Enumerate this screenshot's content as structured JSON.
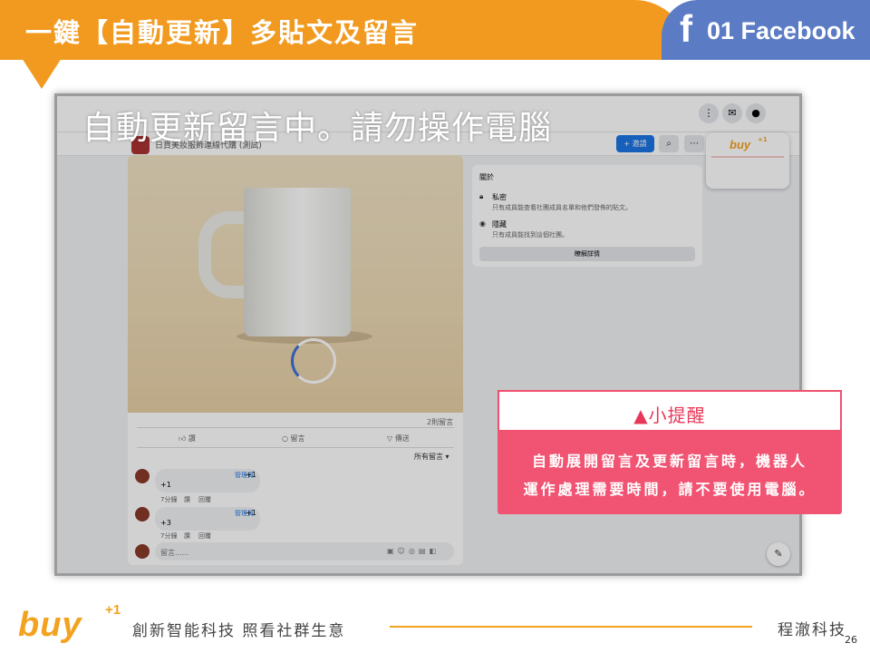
{
  "header": {
    "title": "一鍵【自動更新】多貼文及留言",
    "section_icon": "facebook-f-icon",
    "section_label": "01 Facebook",
    "colors": {
      "orange": "#f19a1f",
      "blue": "#5b7cc4"
    }
  },
  "screenshot": {
    "overlay_message": "自動更新留言中。請勿操作電腦",
    "group_bar": {
      "group_name": "日貨美妝服飾連線代購 (測試)",
      "join_button": "+ 邀請"
    },
    "post": {
      "comment_count": "2則留言",
      "actions": {
        "like": "讚",
        "comment": "留言",
        "share": "傳送"
      },
      "sort_label": "所有留言 ▾",
      "comments": [
        {
          "role": "管理員",
          "extra": "+1",
          "text": "+1",
          "time": "7分鐘",
          "like": "讚",
          "reply": "回覆"
        },
        {
          "role": "管理員",
          "extra": "+1",
          "text": "+3",
          "time": "7分鐘",
          "like": "讚",
          "reply": "回覆"
        }
      ],
      "write_placeholder": "留言......"
    },
    "about": {
      "title": "關於",
      "privacy_label": "私密",
      "privacy_desc": "只有成員能查看社團成員名單和他們發佈的貼文。",
      "visibility_label": "隱藏",
      "visibility_desc": "只有成員能找到這個社團。",
      "learn_more": "瞭解詳情"
    },
    "buy_card_logo": "buy",
    "buy_card_sup": "+1"
  },
  "reminder": {
    "title": "▲小提醒",
    "line1": "自動展開留言及更新留言時，機器人",
    "line2": "運作處理需要時間，請不要使用電腦。",
    "colors": {
      "pink": "#f15473"
    }
  },
  "footer": {
    "logo": "buy",
    "logo_sup": "+1",
    "slogan": "創新智能科技 照看社群生意",
    "company": "程澈科技",
    "page_number": "26"
  }
}
